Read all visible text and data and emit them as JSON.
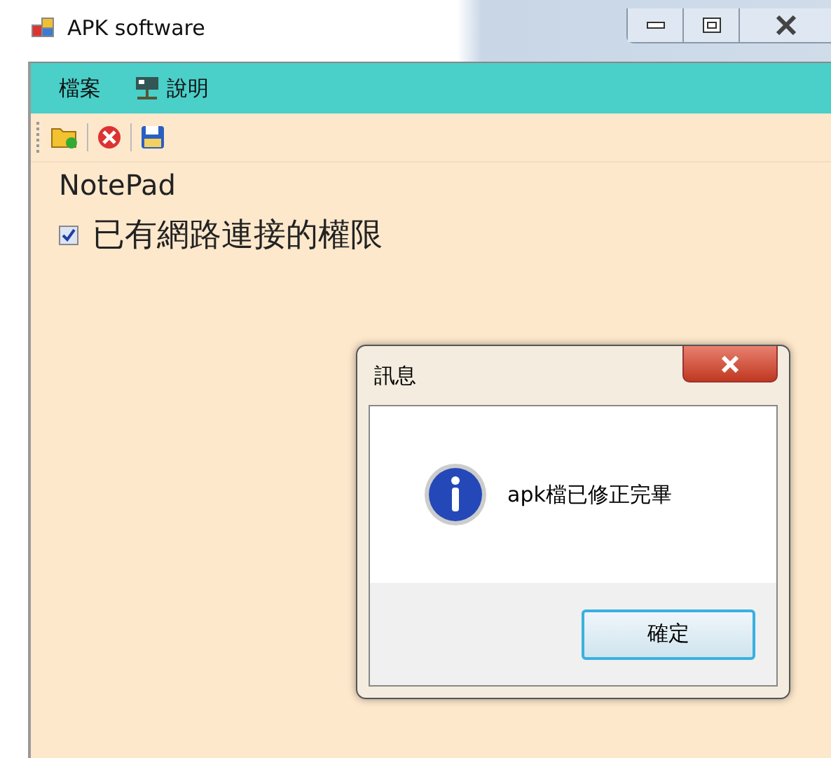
{
  "window": {
    "title": "APK software"
  },
  "menu": [
    {
      "label": "檔案",
      "kind": "plain"
    },
    {
      "label": "說明",
      "kind": "icon"
    }
  ],
  "content": {
    "heading": "NotePad",
    "permission": {
      "label": "已有網路連接的權限",
      "checked": true
    }
  },
  "dialog": {
    "title": "訊息",
    "message": "apk檔已修正完畢",
    "button": "確定"
  }
}
